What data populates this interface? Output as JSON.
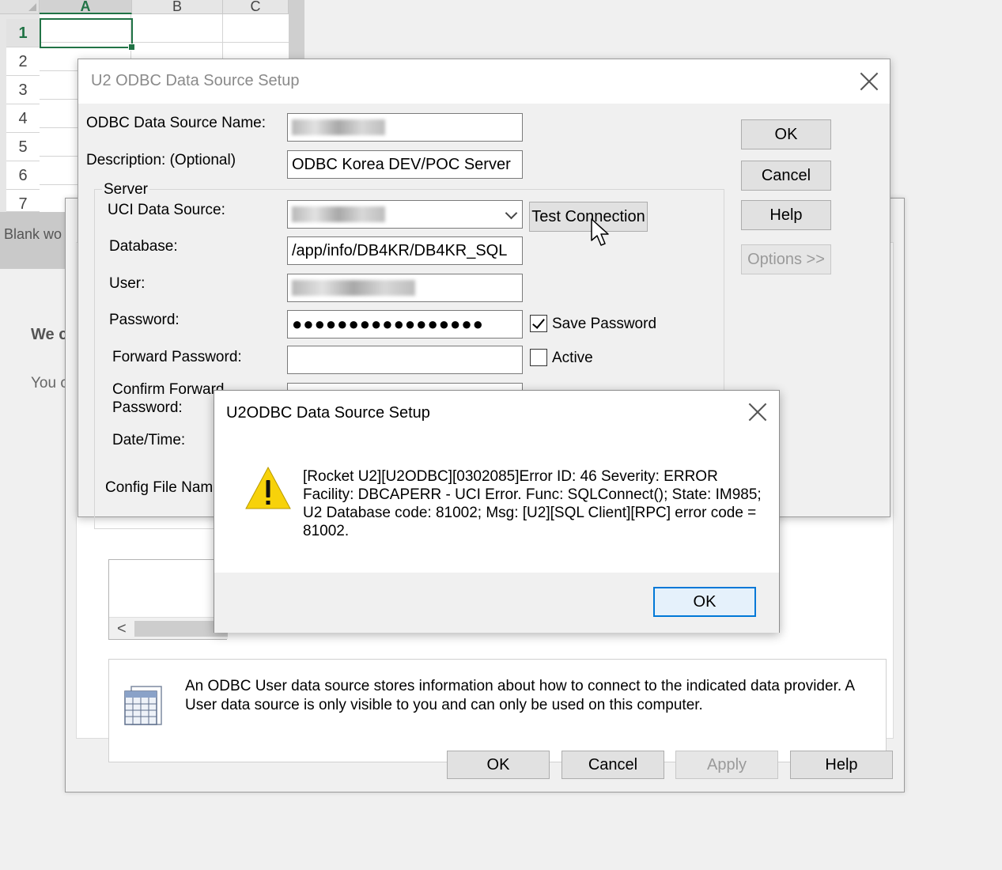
{
  "excel": {
    "columns": [
      "A",
      "B",
      "C"
    ],
    "rows": [
      "1",
      "2",
      "3",
      "4",
      "5",
      "6",
      "7"
    ],
    "blank_label": "Blank wo",
    "bg_text_1": "We c",
    "bg_text_2": "You c"
  },
  "admin": {
    "info_text": "An ODBC User data source stores information about how to connect to the indicated data provider.   A User data source is only visible to you and can only be used on this computer.",
    "buttons": {
      "ok": "OK",
      "cancel": "Cancel",
      "apply": "Apply",
      "help": "Help"
    },
    "scroll_left_glyph": "<"
  },
  "setup": {
    "title": "U2 ODBC Data Source Setup",
    "labels": {
      "dsn": "ODBC Data Source Name:",
      "description": "Description: (Optional)",
      "server_group": "Server",
      "uci": "UCI Data Source:",
      "database": "Database:",
      "user": "User:",
      "password": "Password:",
      "forward_password": "Forward Password:",
      "confirm_forward": "Confirm Forward\nPassword:",
      "datetime": "Date/Time:",
      "config_file": "Config File Name"
    },
    "values": {
      "description": "ODBC Korea DEV/POC Server",
      "database": "/app/info/DB4KR/DB4KR_SQL",
      "password": "●●●●●●●●●●●●●●●●●"
    },
    "save_password": {
      "label": "Save Password",
      "checked": true
    },
    "active": {
      "label": "Active",
      "checked": false
    },
    "buttons": {
      "test_connection": "Test Connection",
      "ok": "OK",
      "cancel": "Cancel",
      "help": "Help",
      "options": "Options >>"
    }
  },
  "error_dialog": {
    "title": "U2ODBC Data Source Setup",
    "message": "[Rocket U2][U2ODBC][0302085]Error ID: 46  Severity: ERROR Facility: DBCAPERR - UCI Error. Func: SQLConnect(); State: IM985; U2 Database code: 81002; Msg: [U2][SQL Client][RPC] error code = 81002.",
    "ok": "OK",
    "icon": "warning-icon"
  },
  "colors": {
    "excel_green": "#217346",
    "focus_blue": "#0078d7",
    "warning_yellow": "#f7d20a"
  }
}
